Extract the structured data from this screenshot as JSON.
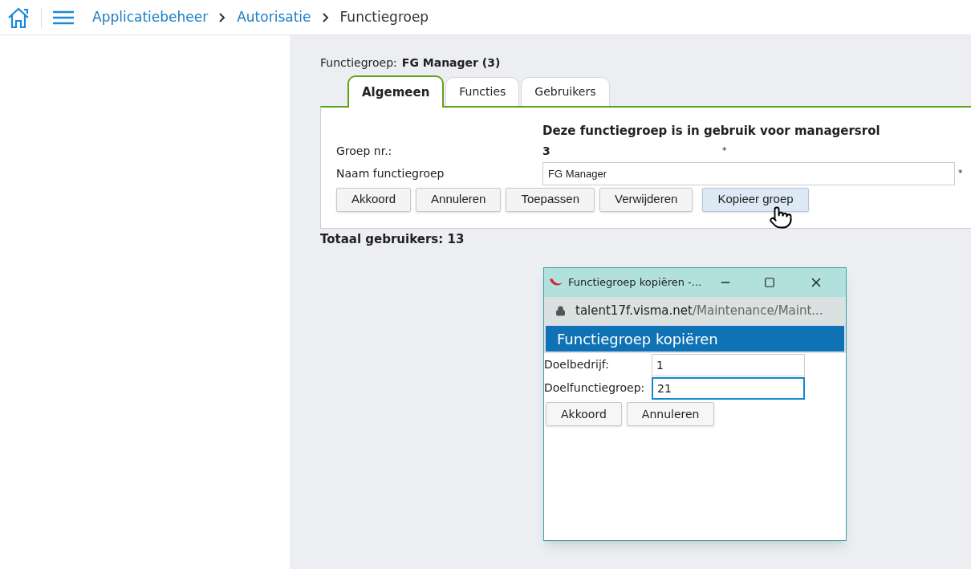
{
  "breadcrumb": [
    {
      "label": "Applicatiebeheer",
      "link": true
    },
    {
      "label": "Autorisatie",
      "link": true
    },
    {
      "label": "Functiegroep",
      "link": false
    }
  ],
  "header": {
    "label": "Functiegroep:",
    "value": "FG Manager (3)"
  },
  "tabs": [
    {
      "label": "Algemeen",
      "selected": true
    },
    {
      "label": "Functies",
      "selected": false
    },
    {
      "label": "Gebruikers",
      "selected": false
    }
  ],
  "notice": "Deze functiegroep is in gebruik voor managersrol",
  "fields": [
    {
      "label": "Groep nr.:",
      "kind": "readonly",
      "value": "3",
      "required_mark": "*"
    },
    {
      "label": "Naam functiegroep",
      "kind": "input",
      "value": "FG Manager",
      "required_mark": "*"
    }
  ],
  "buttons": [
    {
      "label": "Akkoord",
      "hovered": false
    },
    {
      "label": "Annuleren",
      "hovered": false
    },
    {
      "label": "Toepassen",
      "hovered": false
    },
    {
      "label": "Verwijderen",
      "hovered": false
    },
    {
      "label": "Kopieer groep",
      "hovered": true
    }
  ],
  "total": "Totaal gebruikers: 13",
  "popup": {
    "title": "Functiegroep kopiëren -...",
    "url_host": "talent17f.visma.net",
    "url_path": "/Maintenance/Maint...",
    "heading": "Functiegroep kopiëren",
    "fields": [
      {
        "label": "Doelbedrijf:",
        "value": "1",
        "focused": false
      },
      {
        "label": "Doelfunctiegroep:",
        "value": "21",
        "focused": true
      }
    ],
    "buttons": [
      "Akkoord",
      "Annuleren"
    ]
  }
}
